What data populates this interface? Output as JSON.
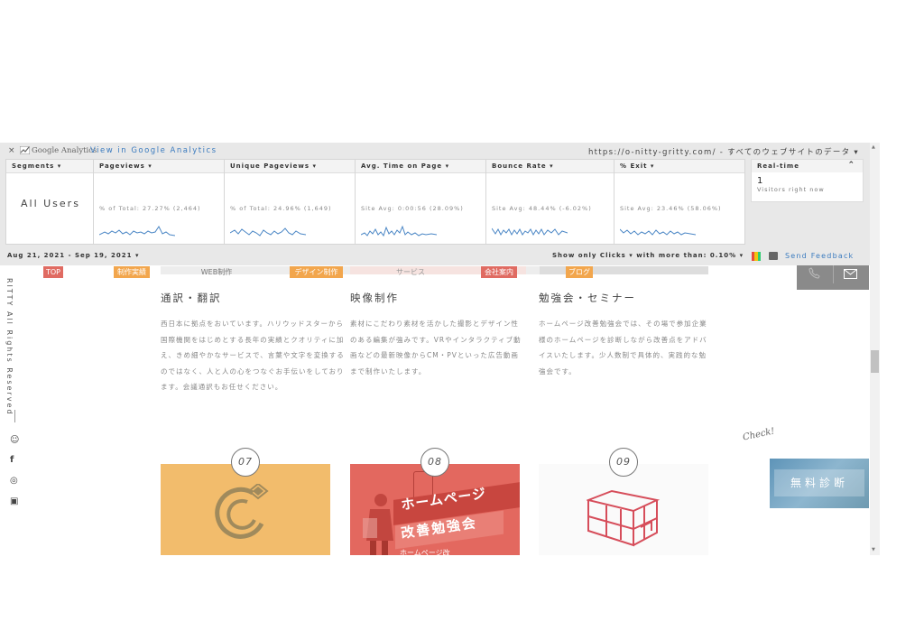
{
  "ga": {
    "close": "×",
    "logo_text": "Google Analytics",
    "view_link": "View in Google Analytics",
    "property": "https://o-nitty-gritty.com/ - すべてのウェブサイトのデータ ▾",
    "segments": {
      "header": "Segments ▾",
      "value": "All Users"
    },
    "metrics": [
      {
        "header": "Pageviews ▾",
        "sub": "% of Total: 27.27% (2,464)"
      },
      {
        "header": "Unique Pageviews ▾",
        "sub": "% of Total: 24.96% (1,649)"
      },
      {
        "header": "Avg. Time on Page ▾",
        "sub": "Site Avg: 0:00:56 (28.09%)"
      },
      {
        "header": "Bounce Rate ▾",
        "sub": "Site Avg: 48.44% (-6.02%)"
      },
      {
        "header": "% Exit ▾",
        "sub": "Site Avg: 23.46% (58.06%)"
      }
    ],
    "realtime": {
      "header": "Real-time",
      "collapse": "⌃",
      "count": "1",
      "label": "Visitors right now"
    },
    "date_range": "Aug 21, 2021 - Sep 19, 2021 ▾",
    "show_only": "Show only Clicks ▾ with more than: 0.10% ▾",
    "feedback": "Send Feedback"
  },
  "page": {
    "categories": [
      {
        "label": "TOP",
        "color": "#e06b62"
      },
      {
        "label": "制作実績",
        "color": "#f2a64d"
      },
      {
        "label": "WEB制作",
        "color": "#777777"
      },
      {
        "label": "デザイン制作",
        "color": "#f2a64d"
      },
      {
        "label": "サービス",
        "color": "#e8a9a3"
      },
      {
        "label": "会社案内",
        "color": "#e06b62"
      },
      {
        "label": "ブログ",
        "color": "#f2a64d"
      }
    ],
    "side_copy": "RITTY All Rights Reserved",
    "social": {
      "line": "☺",
      "facebook": "f",
      "instagram": "◎",
      "youtube": "▣"
    },
    "services": [
      {
        "title": "通訳・翻訳",
        "desc": "西日本に拠点をおいています。ハリウッドスターから国際機関をはじめとする長年の実績とクオリティに加え、きめ細やかなサービスで、言葉や文字を変換するのではなく、人と人の心をつなぐお手伝いをしております。会議通訳もお任せください。"
      },
      {
        "title": "映像制作",
        "desc": "素材にこだわり素材を活かした撮影とデザイン性のある編集が強みです。VRやインタラクティブ動画などの最新映像からCM・PVといった広告動画まで制作いたします。"
      },
      {
        "title": "勉強会・セミナー",
        "desc": "ホームページ改善勉強会では、その場で参加企業様のホームページを診断しながら改善点をアドバイスいたします。少人数制で具体的、実践的な勉強会です。"
      }
    ],
    "cards": [
      {
        "number": "07",
        "color": "#f2bc6c"
      },
      {
        "number": "08",
        "color": "#e3685f",
        "title1": "ホームページ",
        "title2": "改善勉強会",
        "footer": "ホームページ改"
      },
      {
        "number": "09",
        "color": "#fafafa"
      }
    ],
    "diagnosis": {
      "label": "無料診断",
      "check": "Check!"
    }
  }
}
